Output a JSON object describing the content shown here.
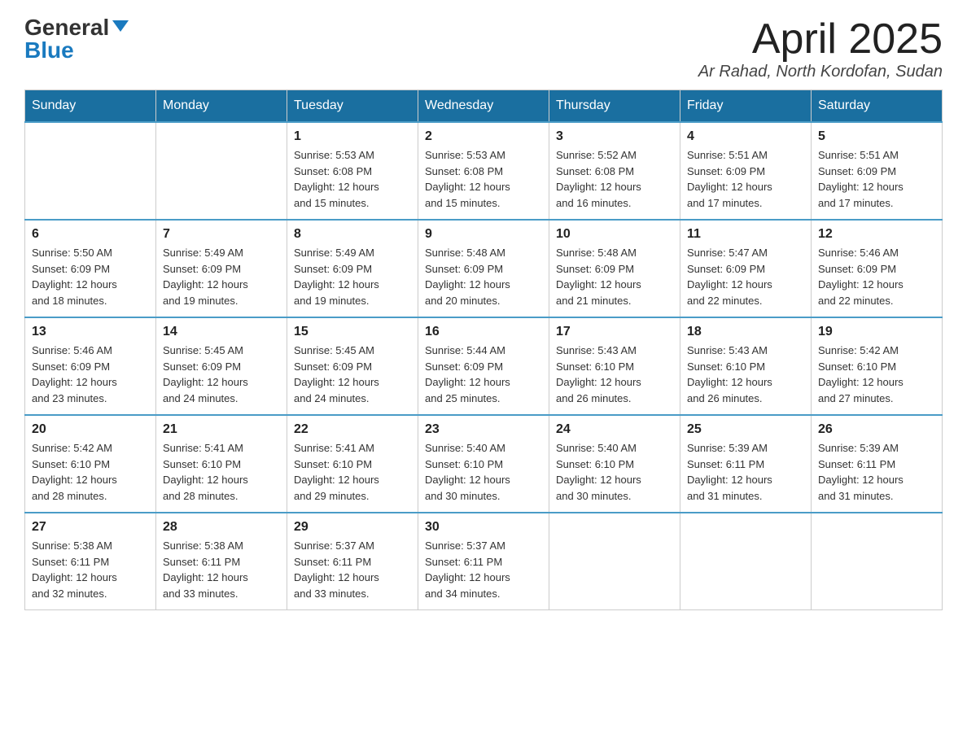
{
  "logo": {
    "general": "General",
    "blue": "Blue"
  },
  "title": "April 2025",
  "location": "Ar Rahad, North Kordofan, Sudan",
  "headers": [
    "Sunday",
    "Monday",
    "Tuesday",
    "Wednesday",
    "Thursday",
    "Friday",
    "Saturday"
  ],
  "weeks": [
    [
      {
        "day": "",
        "info": ""
      },
      {
        "day": "",
        "info": ""
      },
      {
        "day": "1",
        "info": "Sunrise: 5:53 AM\nSunset: 6:08 PM\nDaylight: 12 hours\nand 15 minutes."
      },
      {
        "day": "2",
        "info": "Sunrise: 5:53 AM\nSunset: 6:08 PM\nDaylight: 12 hours\nand 15 minutes."
      },
      {
        "day": "3",
        "info": "Sunrise: 5:52 AM\nSunset: 6:08 PM\nDaylight: 12 hours\nand 16 minutes."
      },
      {
        "day": "4",
        "info": "Sunrise: 5:51 AM\nSunset: 6:09 PM\nDaylight: 12 hours\nand 17 minutes."
      },
      {
        "day": "5",
        "info": "Sunrise: 5:51 AM\nSunset: 6:09 PM\nDaylight: 12 hours\nand 17 minutes."
      }
    ],
    [
      {
        "day": "6",
        "info": "Sunrise: 5:50 AM\nSunset: 6:09 PM\nDaylight: 12 hours\nand 18 minutes."
      },
      {
        "day": "7",
        "info": "Sunrise: 5:49 AM\nSunset: 6:09 PM\nDaylight: 12 hours\nand 19 minutes."
      },
      {
        "day": "8",
        "info": "Sunrise: 5:49 AM\nSunset: 6:09 PM\nDaylight: 12 hours\nand 19 minutes."
      },
      {
        "day": "9",
        "info": "Sunrise: 5:48 AM\nSunset: 6:09 PM\nDaylight: 12 hours\nand 20 minutes."
      },
      {
        "day": "10",
        "info": "Sunrise: 5:48 AM\nSunset: 6:09 PM\nDaylight: 12 hours\nand 21 minutes."
      },
      {
        "day": "11",
        "info": "Sunrise: 5:47 AM\nSunset: 6:09 PM\nDaylight: 12 hours\nand 22 minutes."
      },
      {
        "day": "12",
        "info": "Sunrise: 5:46 AM\nSunset: 6:09 PM\nDaylight: 12 hours\nand 22 minutes."
      }
    ],
    [
      {
        "day": "13",
        "info": "Sunrise: 5:46 AM\nSunset: 6:09 PM\nDaylight: 12 hours\nand 23 minutes."
      },
      {
        "day": "14",
        "info": "Sunrise: 5:45 AM\nSunset: 6:09 PM\nDaylight: 12 hours\nand 24 minutes."
      },
      {
        "day": "15",
        "info": "Sunrise: 5:45 AM\nSunset: 6:09 PM\nDaylight: 12 hours\nand 24 minutes."
      },
      {
        "day": "16",
        "info": "Sunrise: 5:44 AM\nSunset: 6:09 PM\nDaylight: 12 hours\nand 25 minutes."
      },
      {
        "day": "17",
        "info": "Sunrise: 5:43 AM\nSunset: 6:10 PM\nDaylight: 12 hours\nand 26 minutes."
      },
      {
        "day": "18",
        "info": "Sunrise: 5:43 AM\nSunset: 6:10 PM\nDaylight: 12 hours\nand 26 minutes."
      },
      {
        "day": "19",
        "info": "Sunrise: 5:42 AM\nSunset: 6:10 PM\nDaylight: 12 hours\nand 27 minutes."
      }
    ],
    [
      {
        "day": "20",
        "info": "Sunrise: 5:42 AM\nSunset: 6:10 PM\nDaylight: 12 hours\nand 28 minutes."
      },
      {
        "day": "21",
        "info": "Sunrise: 5:41 AM\nSunset: 6:10 PM\nDaylight: 12 hours\nand 28 minutes."
      },
      {
        "day": "22",
        "info": "Sunrise: 5:41 AM\nSunset: 6:10 PM\nDaylight: 12 hours\nand 29 minutes."
      },
      {
        "day": "23",
        "info": "Sunrise: 5:40 AM\nSunset: 6:10 PM\nDaylight: 12 hours\nand 30 minutes."
      },
      {
        "day": "24",
        "info": "Sunrise: 5:40 AM\nSunset: 6:10 PM\nDaylight: 12 hours\nand 30 minutes."
      },
      {
        "day": "25",
        "info": "Sunrise: 5:39 AM\nSunset: 6:11 PM\nDaylight: 12 hours\nand 31 minutes."
      },
      {
        "day": "26",
        "info": "Sunrise: 5:39 AM\nSunset: 6:11 PM\nDaylight: 12 hours\nand 31 minutes."
      }
    ],
    [
      {
        "day": "27",
        "info": "Sunrise: 5:38 AM\nSunset: 6:11 PM\nDaylight: 12 hours\nand 32 minutes."
      },
      {
        "day": "28",
        "info": "Sunrise: 5:38 AM\nSunset: 6:11 PM\nDaylight: 12 hours\nand 33 minutes."
      },
      {
        "day": "29",
        "info": "Sunrise: 5:37 AM\nSunset: 6:11 PM\nDaylight: 12 hours\nand 33 minutes."
      },
      {
        "day": "30",
        "info": "Sunrise: 5:37 AM\nSunset: 6:11 PM\nDaylight: 12 hours\nand 34 minutes."
      },
      {
        "day": "",
        "info": ""
      },
      {
        "day": "",
        "info": ""
      },
      {
        "day": "",
        "info": ""
      }
    ]
  ]
}
